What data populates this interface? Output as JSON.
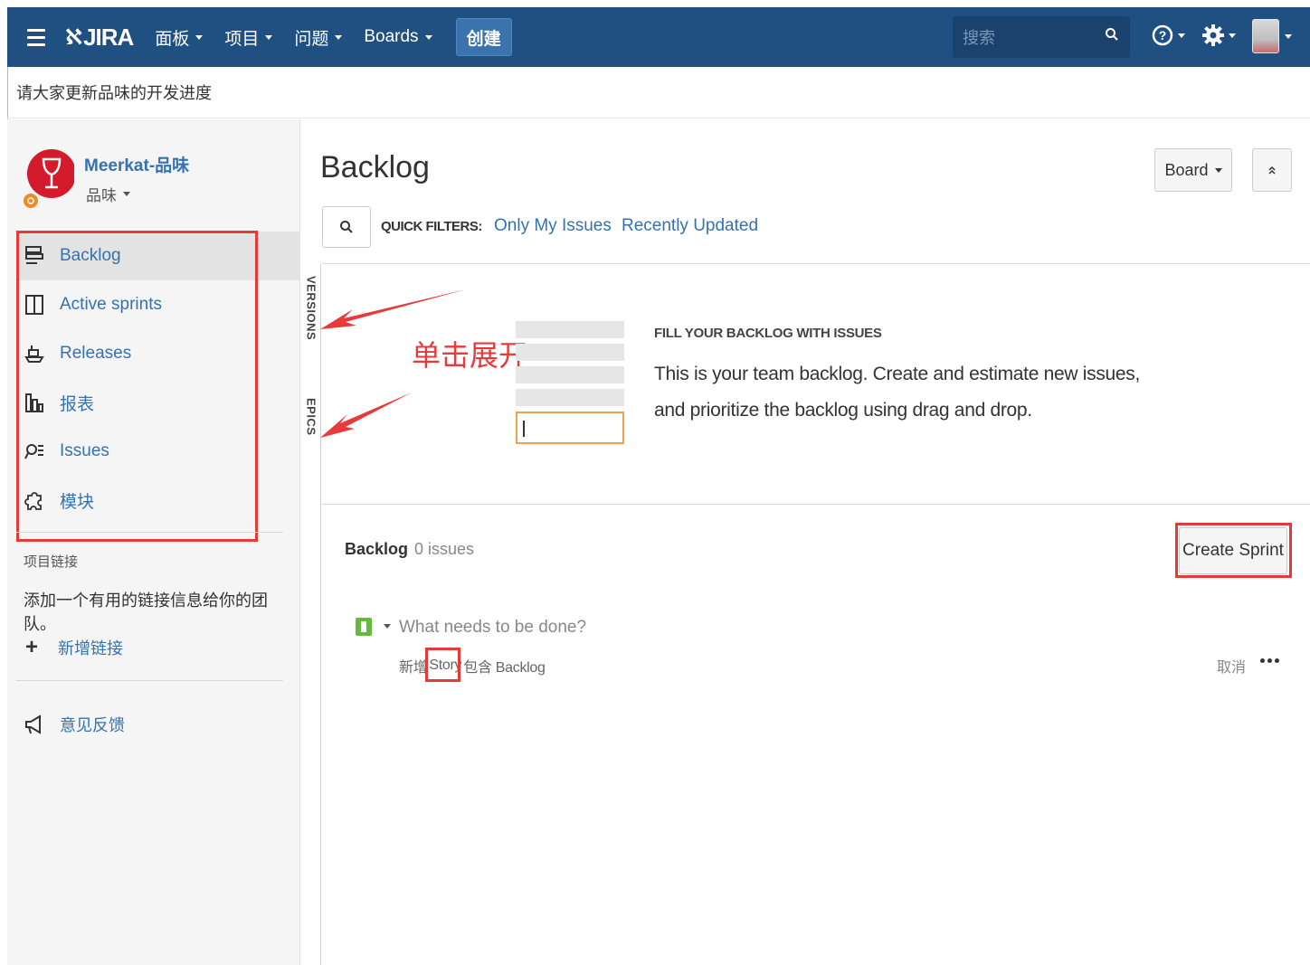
{
  "header": {
    "logo": "JIRA",
    "menu": [
      {
        "label": "面板"
      },
      {
        "label": "项目"
      },
      {
        "label": "问题"
      },
      {
        "label": "Boards"
      }
    ],
    "create_label": "创建",
    "search_placeholder": "搜索"
  },
  "announcement": "请大家更新品味的开发进度",
  "sidebar": {
    "project_name": "Meerkat-品味",
    "project_sub": "品味",
    "items": [
      {
        "label": "Backlog",
        "icon": "backlog-icon"
      },
      {
        "label": "Active sprints",
        "icon": "board-icon"
      },
      {
        "label": "Releases",
        "icon": "ship-icon"
      },
      {
        "label": "报表",
        "icon": "chart-icon"
      },
      {
        "label": "Issues",
        "icon": "issues-icon"
      },
      {
        "label": "模块",
        "icon": "puzzle-icon"
      }
    ],
    "links_title": "项目链接",
    "links_desc": "添加一个有用的链接信息给你的团队。",
    "add_link": "新增链接",
    "feedback": "意见反馈"
  },
  "main": {
    "title": "Backlog",
    "board_button": "Board",
    "quick_filters_label": "QUICK FILTERS:",
    "filters": [
      "Only My Issues",
      "Recently Updated"
    ],
    "side_tabs": {
      "versions": "VERSIONS",
      "epics": "EPICS"
    },
    "annotation": "单击展开",
    "empty_heading": "FILL YOUR BACKLOG WITH ISSUES",
    "empty_line1": "This is your team backlog. Create and estimate new issues,",
    "empty_line2": "and prioritize the backlog using drag and drop.",
    "backlog_label": "Backlog",
    "backlog_count": "0 issues",
    "create_sprint": "Create Sprint",
    "todo_placeholder": "What needs to be done?",
    "hint_prefix": "新增",
    "hint_type": "Story",
    "hint_suffix": "包含 Backlog",
    "cancel": "取消"
  },
  "colors": {
    "nav_bg": "#205081",
    "link": "#3572b0",
    "annotation_red": "#e53a3a",
    "story_green": "#63ba3c"
  }
}
